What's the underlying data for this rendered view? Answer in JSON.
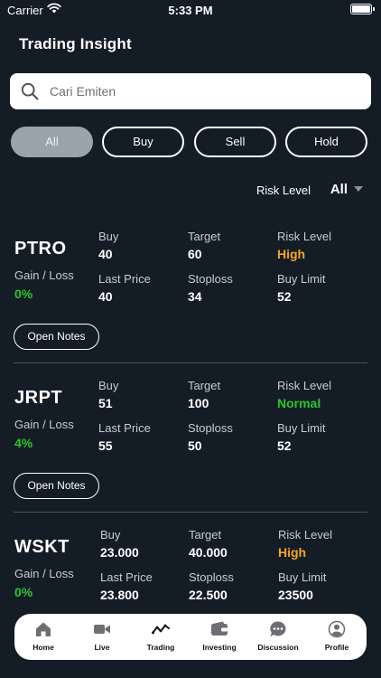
{
  "status_bar": {
    "carrier": "Carrier",
    "time": "5:33 PM"
  },
  "header": {
    "title": "Trading Insight"
  },
  "search": {
    "placeholder": "Cari Emiten"
  },
  "filters": [
    {
      "label": "All",
      "active": true
    },
    {
      "label": "Buy",
      "active": false
    },
    {
      "label": "Sell",
      "active": false
    },
    {
      "label": "Hold",
      "active": false
    }
  ],
  "risk_filter": {
    "label": "Risk Level",
    "value": "All"
  },
  "labels": {
    "buy": "Buy",
    "target": "Target",
    "risk_level": "Risk Level",
    "gain_loss": "Gain / Loss",
    "last_price": "Last Price",
    "stoploss": "Stoploss",
    "buy_limit": "Buy Limit",
    "open_notes": "Open Notes"
  },
  "stocks": [
    {
      "ticker": "PTRO",
      "buy": "40",
      "target": "60",
      "risk_level": "High",
      "risk_color": "#f5a524",
      "gain_loss": "0%",
      "last_price": "40",
      "stoploss": "34",
      "buy_limit": "52"
    },
    {
      "ticker": "JRPT",
      "buy": "51",
      "target": "100",
      "risk_level": "Normal",
      "risk_color": "#2cc52c",
      "gain_loss": "4%",
      "last_price": "55",
      "stoploss": "50",
      "buy_limit": "52"
    },
    {
      "ticker": "WSKT",
      "buy": "23.000",
      "target": "40.000",
      "risk_level": "High",
      "risk_color": "#f5a524",
      "gain_loss": "0%",
      "last_price": "23.800",
      "stoploss": "22.500",
      "buy_limit": "23500"
    }
  ],
  "bottom_nav": [
    {
      "label": "Home",
      "icon": "home-icon"
    },
    {
      "label": "Live",
      "icon": "video-icon"
    },
    {
      "label": "Trading",
      "icon": "trend-icon"
    },
    {
      "label": "Investing",
      "icon": "wallet-icon"
    },
    {
      "label": "Discussion",
      "icon": "chat-icon"
    },
    {
      "label": "Profile",
      "icon": "profile-icon"
    }
  ],
  "colors": {
    "background": "#141d26",
    "gain": "#2cc52c",
    "risk_high": "#f5a524",
    "active_filter": "#9aa3ab"
  }
}
